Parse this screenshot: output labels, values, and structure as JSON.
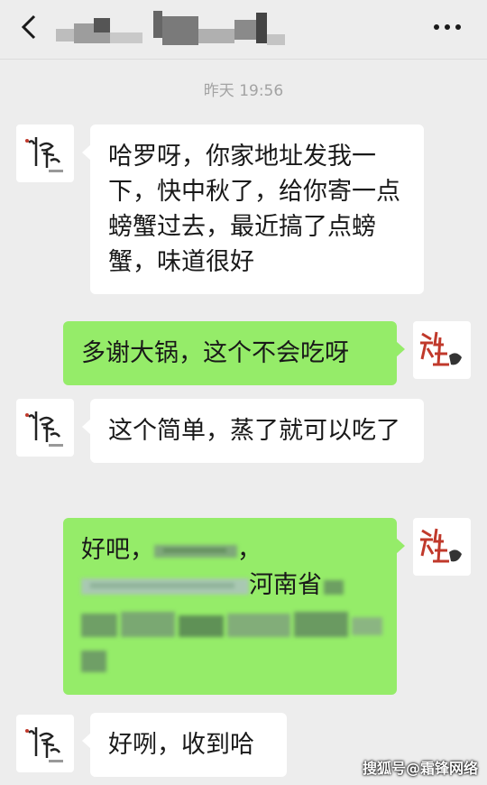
{
  "header": {
    "back_icon": "chevron-left-icon",
    "more_icon": "more-dots-icon"
  },
  "timestamp": "昨天 19:56",
  "avatars": {
    "contact_logo": "墨东",
    "self_logo": "微生"
  },
  "messages": [
    {
      "side": "left",
      "text": "哈罗呀，你家地址发我一下，快中秋了，给你寄一点螃蟹过去，最近搞了点螃蟹，味道很好"
    },
    {
      "side": "right",
      "text": "多谢大锅，这个不会吃呀"
    },
    {
      "side": "left",
      "text": "这个简单，蒸了就可以吃了"
    },
    {
      "side": "right",
      "prefix": "好吧，",
      "comma": "，",
      "province": "河南省"
    },
    {
      "side": "left",
      "text": "好咧，收到哈"
    }
  ],
  "watermark": "搜狐号@霜锋网络",
  "colors": {
    "background": "#ededed",
    "sent_bubble": "#95ec69",
    "received_bubble": "#ffffff"
  }
}
